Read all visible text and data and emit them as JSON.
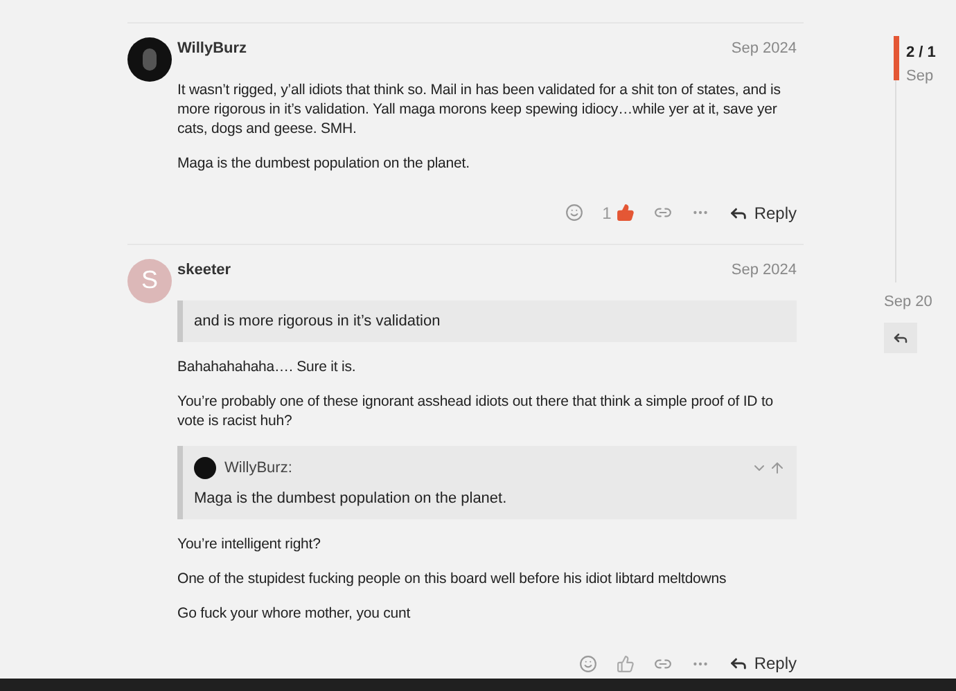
{
  "posts": [
    {
      "author": "WillyBurz",
      "date": "Sep 2024",
      "avatar": {
        "kind": "image"
      },
      "body": [
        {
          "kind": "paragraph",
          "text": "It wasn’t rigged, y’all idiots that think so. Mail in has been validated for a shit ton of states, and is more rigorous in it’s validation. Yall maga morons keep spewing idiocy…while yer at it, save yer cats, dogs and geese. SMH."
        },
        {
          "kind": "paragraph",
          "text": "Maga is the dumbest population on the planet."
        }
      ],
      "like_count": "1",
      "liked": true,
      "reply_label": "Reply"
    },
    {
      "author": "skeeter",
      "date": "Sep 2024",
      "avatar": {
        "kind": "letter",
        "letter": "S",
        "color": "#dcb8b8"
      },
      "body": [
        {
          "kind": "quote",
          "text": "and is more rigorous in it’s validation"
        },
        {
          "kind": "paragraph",
          "text": "Bahahahahaha…. Sure it is."
        },
        {
          "kind": "paragraph",
          "text": "You’re probably one of these ignorant asshead idiots out there that think a simple proof of ID to vote is racist huh?"
        },
        {
          "kind": "quote",
          "author": "WillyBurz:",
          "text": "Maga is the dumbest population on the planet."
        },
        {
          "kind": "paragraph",
          "text": "You’re intelligent right?"
        },
        {
          "kind": "paragraph",
          "text": "One of the stupidest fucking people on this board well before his idiot libtard meltdowns"
        },
        {
          "kind": "paragraph",
          "text": "Go fuck your whore mother, you cunt"
        }
      ],
      "liked": false,
      "reply_label": "Reply"
    }
  ],
  "timeline": {
    "position": "2 / 1",
    "position_date": "Sep",
    "end_date": "Sep 20"
  }
}
